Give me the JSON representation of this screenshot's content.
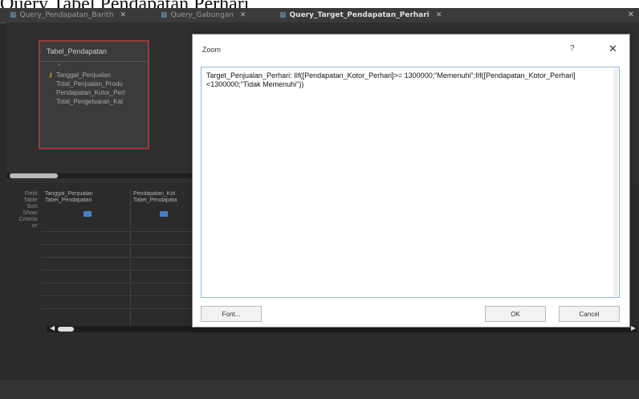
{
  "caption": "Query Tabel Pendapatan Perhari",
  "tabs": [
    {
      "label": "Query_Pendapatan_Barith",
      "active": false
    },
    {
      "label": "Query_Gabungan",
      "active": false
    },
    {
      "label": "Query_Target_Pendapatan_Perhari",
      "active": true
    }
  ],
  "tab_close_glyph": "✕",
  "window_close_glyph": "✕",
  "table_box": {
    "title": "Tabel_Pendapatan",
    "star": "*",
    "fields": [
      "Tanggal_Penjualan",
      "Total_Penjualan_Produ",
      "Pendapatan_Kotor_Perl",
      "Total_Pengeluaran_Kat"
    ]
  },
  "grid": {
    "row_labels": [
      "Field:",
      "Table:",
      "Sort:",
      "Show:",
      "Criteria:",
      "or:"
    ],
    "columns": [
      {
        "field": "Tanggal_Penjualan",
        "table": "Tabel_Pendapatan"
      },
      {
        "field": "Pendapatan_Kot",
        "table": "Tabel_Pendapata"
      }
    ]
  },
  "zoom_dialog": {
    "title": "Zoom",
    "help": "?",
    "close": "✕",
    "expression": "Target_Penjualan_Perhari: IIf([Pendapatan_Kotor_Perhari]>= 1300000;\"Memenuhi\";IIf([Pendapatan_Kotor_Perhari]<1300000;\"Tidak Memenuhi\"))",
    "font_button": "Font...",
    "ok_button": "OK",
    "cancel_button": "Cancel"
  },
  "colors": {
    "background": "#2b2b2b",
    "accent_red": "#9a3a3a",
    "checkbox_blue": "#4a7fc8"
  }
}
